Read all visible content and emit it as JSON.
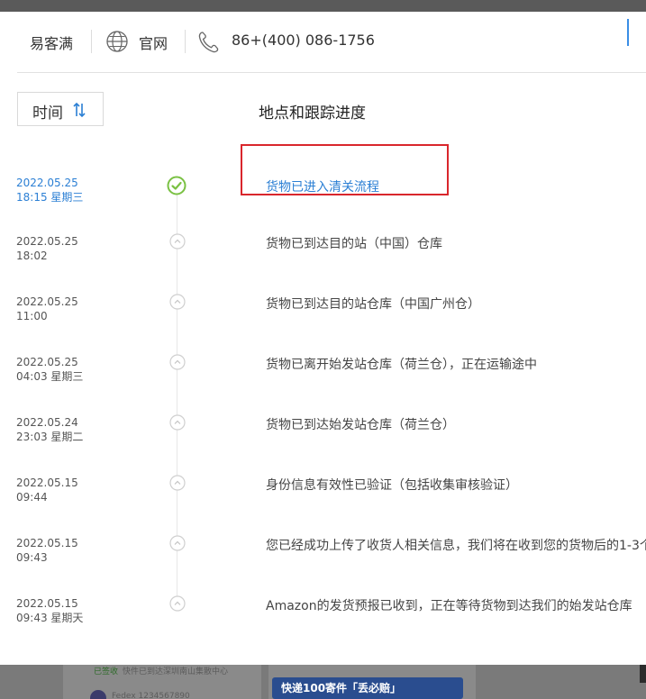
{
  "header": {
    "brand": "易客满",
    "site_label": "官网",
    "phone": "86+(400) 086-1756",
    "icons": {
      "site": "globe-icon",
      "phone": "phone-icon"
    }
  },
  "table": {
    "sort_label": "时间",
    "sort_icon": "sort-arrows-icon",
    "column_title": "地点和跟踪进度"
  },
  "events": [
    {
      "date": "2022.05.25",
      "time": "18:15 星期三",
      "text": "货物已进入清关流程",
      "status": "current"
    },
    {
      "date": "2022.05.25",
      "time": "18:02",
      "text": "货物已到达目的站（中国）仓库",
      "status": "past"
    },
    {
      "date": "2022.05.25",
      "time": "11:00",
      "text": "货物已到达目的站仓库（中国广州仓）",
      "status": "past"
    },
    {
      "date": "2022.05.25",
      "time": "04:03 星期三",
      "text": "货物已离开始发站仓库（荷兰仓），正在运输途中",
      "status": "past"
    },
    {
      "date": "2022.05.24",
      "time": "23:03 星期二",
      "text": "货物已到达始发站仓库（荷兰仓）",
      "status": "past"
    },
    {
      "date": "2022.05.15",
      "time": "09:44",
      "text": "身份信息有效性已验证（包括收集审核验证）",
      "status": "past"
    },
    {
      "date": "2022.05.15",
      "time": "09:43",
      "text": "您已经成功上传了收货人相关信息，我们将在收到您的货物后的1-3个",
      "status": "past"
    },
    {
      "date": "2022.05.15",
      "time": "09:43 星期天",
      "text": "Amazon的发货预报已收到，正在等待货物到达我们的始发站仓库",
      "status": "past"
    }
  ],
  "backdrop": {
    "status_tag": "已签收",
    "line1": "快件已到达深圳南山集散中心",
    "line2": "Fedex  1234567890",
    "banner": "快递100寄件「丢必赔」"
  },
  "colors": {
    "accent": "#2b7fd4",
    "done": "#7ac143",
    "highlight": "#d9262c"
  }
}
